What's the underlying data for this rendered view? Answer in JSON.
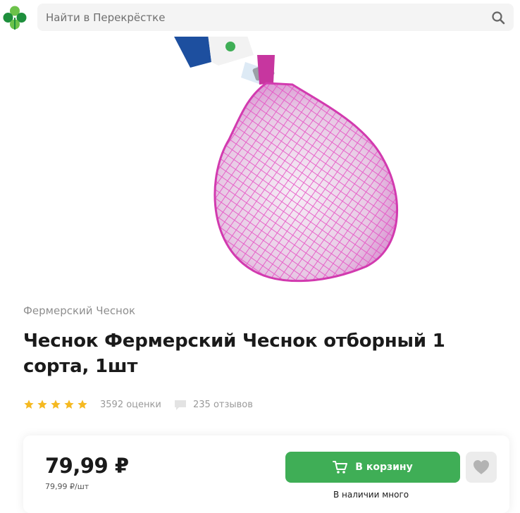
{
  "header": {
    "search_placeholder": "Найти в Перекрёстке"
  },
  "colors": {
    "brand_green": "#3fae56",
    "logo_green_dark": "#1e8f3c",
    "logo_green_light": "#6cc24a",
    "star": "#f5b921",
    "net_pink": "#e64fc3"
  },
  "product": {
    "brand": "Фермерский Чеснок",
    "title": "Чеснок Фермерский Чеснок отборный 1 сорта, 1шт",
    "rating": {
      "stars": 5,
      "ratings_count": "3592 оценки",
      "reviews_count": "235 отзывов"
    }
  },
  "buy": {
    "price": "79,99 ₽",
    "unit_price": "79,99 ₽/шт",
    "add_to_cart": "В корзину",
    "availability": "В наличии много"
  },
  "icons": {
    "logo": "clover-logo-icon",
    "search": "search-icon",
    "star": "star-icon",
    "reviews": "comment-icon",
    "cart": "cart-icon",
    "favorite": "heart-icon"
  }
}
